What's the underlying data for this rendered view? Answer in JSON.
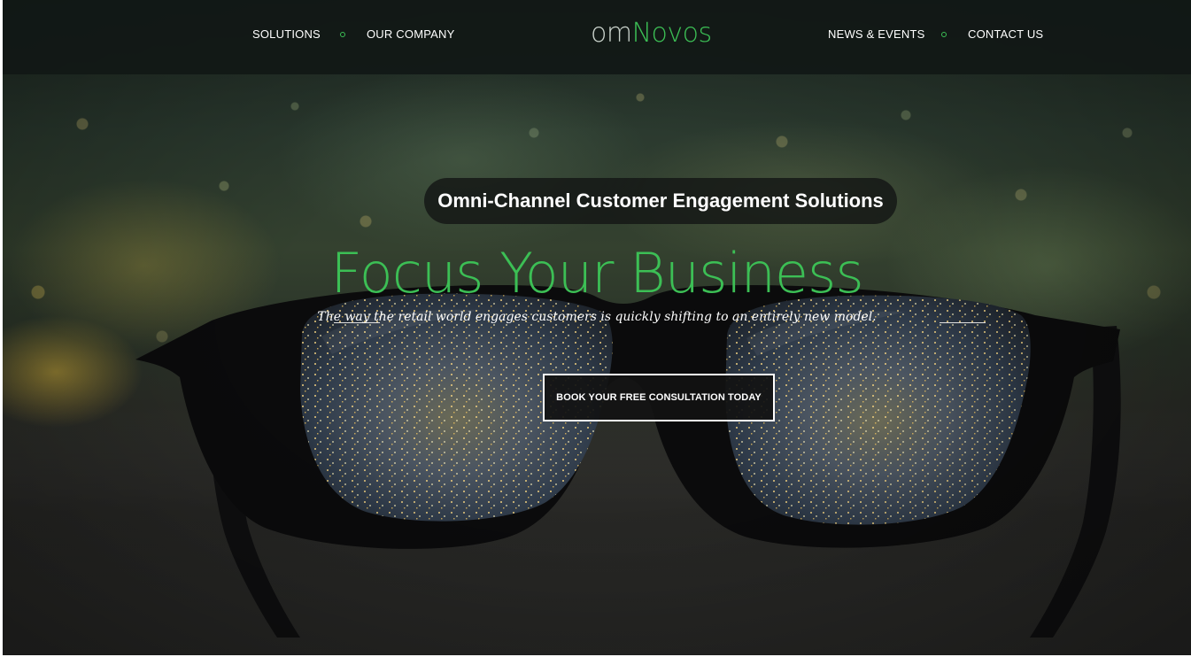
{
  "header": {
    "logo": {
      "part1": "om",
      "part2": "Novos"
    },
    "nav_left": [
      {
        "label": "SOLUTIONS"
      },
      {
        "label": "OUR COMPANY"
      }
    ],
    "nav_right": [
      {
        "label": "NEWS & EVENTS"
      },
      {
        "label": "CONTACT US"
      }
    ],
    "separator_icon": "circle-dot-icon"
  },
  "hero": {
    "tagline": "Omni-Channel Customer Engagement Solutions",
    "headline": "Focus Your Business",
    "subheadline": "The way the retail world engages customers is quickly shifting to an entirely new model.",
    "cta_label": "BOOK YOUR FREE CONSULTATION TODAY",
    "background_image": "eyeglasses-over-city-night-image"
  },
  "colors": {
    "accent": "#3cbf55",
    "header_bg": "#111816",
    "text": "#ffffff"
  }
}
